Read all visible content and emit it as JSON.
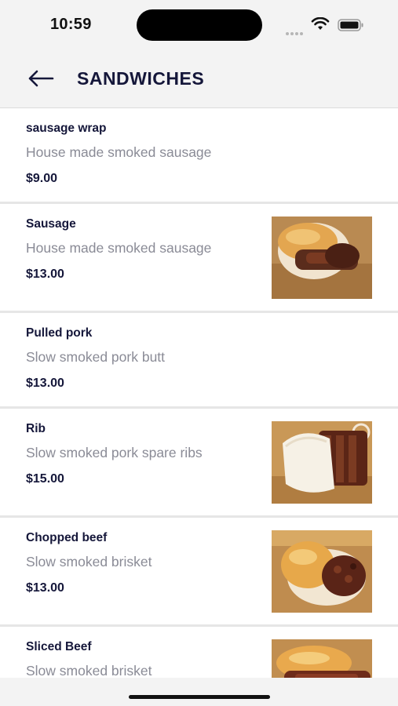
{
  "status_bar": {
    "time": "10:59",
    "icons": [
      "signal-icon",
      "wifi-icon",
      "battery-icon"
    ]
  },
  "header": {
    "back_icon": "arrow-left-icon",
    "title": "SANDWICHES"
  },
  "colors": {
    "primary_text": "#15173a",
    "secondary_text": "#8a8b96",
    "header_bg": "#f3f3f3",
    "divider": "#e6e6e6"
  },
  "items": [
    {
      "name": "sausage wrap",
      "description": "House made smoked sausage",
      "price": "$9.00",
      "has_image": false
    },
    {
      "name": "Sausage",
      "description": "House made smoked sausage",
      "price": "$13.00",
      "has_image": true,
      "image": "sausage-sandwich-photo"
    },
    {
      "name": "Pulled pork",
      "description": "Slow smoked pork butt",
      "price": "$13.00",
      "has_image": false
    },
    {
      "name": "Rib",
      "description": "Slow smoked pork spare ribs",
      "price": "$15.00",
      "has_image": true,
      "image": "rib-sandwich-photo"
    },
    {
      "name": "Chopped beef",
      "description": "Slow smoked brisket",
      "price": "$13.00",
      "has_image": true,
      "image": "chopped-beef-sandwich-photo"
    },
    {
      "name": "Sliced Beef",
      "description": "Slow smoked brisket",
      "price": "",
      "has_image": true,
      "image": "sliced-beef-sandwich-photo"
    }
  ]
}
